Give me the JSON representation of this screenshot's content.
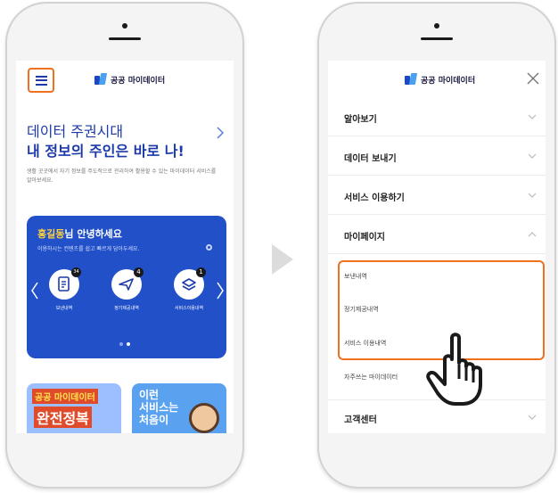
{
  "left_phone": {
    "logo_text": "공공 마이데이터",
    "hero": {
      "line1": "데이터 주권시대",
      "line2": "내 정보의 주인은 바로 나!",
      "description": "생활 곳곳에서 자기 정보를 주도적으로 관리하여 활용할 수 있는 마이데이터 서비스를 알아보세요."
    },
    "card": {
      "name": "홍길동",
      "greeting_suffix": "님 안녕하세요",
      "subtitle": "이용하시는 컨텐츠를 쉽고 빠르게 담아두세요.",
      "items": [
        {
          "label": "보낸내역",
          "badge": "34",
          "icon": "document-icon"
        },
        {
          "label": "정기제공내역",
          "badge": "4",
          "icon": "send-icon"
        },
        {
          "label": "서비스이용내역",
          "badge": "1",
          "icon": "stack-icon"
        }
      ]
    },
    "banners": {
      "b1_line1": "공공 마이데이터",
      "b1_line2": "완전정복",
      "b2_line1": "이런",
      "b2_line2": "서비스는",
      "b2_line3": "처음이"
    }
  },
  "right_phone": {
    "logo_text": "공공 마이데이터",
    "menu": [
      {
        "label": "알아보기",
        "state": "collapsed"
      },
      {
        "label": "데이터 보내기",
        "state": "collapsed"
      },
      {
        "label": "서비스 이용하기",
        "state": "collapsed"
      },
      {
        "label": "마이페이지",
        "state": "expanded"
      }
    ],
    "submenu": [
      "보낸내역",
      "정기제공내역",
      "서비스 이용내역",
      "자주쓰는 마이데이터"
    ],
    "last_menu": {
      "label": "고객센터",
      "state": "collapsed"
    }
  },
  "colors": {
    "accent": "#f07020",
    "brand": "#1c3aa9",
    "card": "#2150c8"
  }
}
